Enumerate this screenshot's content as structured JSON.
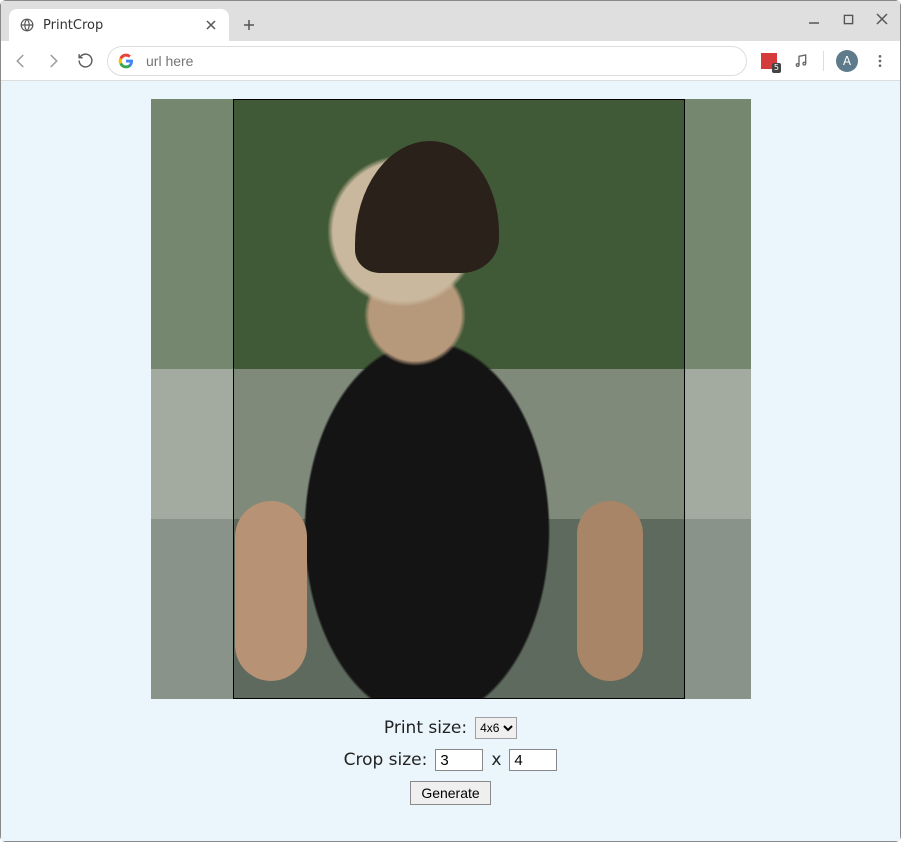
{
  "window": {
    "tab_title": "PrintCrop",
    "avatar_letter": "A",
    "ext_badge": "5"
  },
  "omnibox": {
    "placeholder": "url here",
    "value": ""
  },
  "app": {
    "print_size_label": "Print size:",
    "print_size_selected": "4x6",
    "crop_size_label": "Crop size:",
    "crop_w": "3",
    "crop_h": "4",
    "crop_sep": "x",
    "generate_label": "Generate"
  }
}
